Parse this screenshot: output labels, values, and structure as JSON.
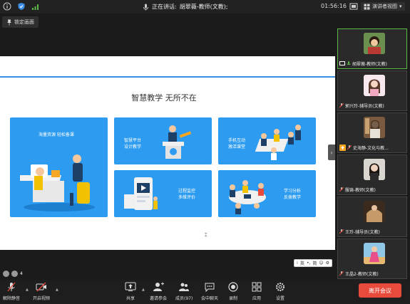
{
  "topbar": {
    "speaking_prefix": "正在讲话:",
    "speaker": "胡翠薇-教师(文教);",
    "time": "01:56:16",
    "view_label": "演讲者视图"
  },
  "lock_label": "锁定画面",
  "slide": {
    "title": "智慧教学 无所不在",
    "cards": [
      {
        "lines": [
          "海量资源 轻松备课"
        ]
      },
      {
        "lines": [
          "智慧平台",
          "设计教学"
        ]
      },
      {
        "lines": [
          "手机互动",
          "激活课堂"
        ]
      },
      {
        "lines": [
          "过程监控",
          "多维评价"
        ]
      },
      {
        "lines": [
          "学习分析",
          "反拨教学"
        ]
      }
    ]
  },
  "ime": {
    "en": "英",
    "simplified": "简"
  },
  "page_number": "4",
  "participants": [
    {
      "name": "胡翠薇-教师(文教)"
    },
    {
      "name": "郭兴玲-辅导员(文教)"
    },
    {
      "name": "史海静-文化与教..."
    },
    {
      "name": "殷铸-教师(文教)"
    },
    {
      "name": "王玲-辅导员(文教)"
    },
    {
      "name": "王晶2-教师(文教)"
    }
  ],
  "toolbar": {
    "mute": "解除静音",
    "video": "开启视频",
    "share": "共享",
    "invite": "邀请参会",
    "members": "成员(97)",
    "chat": "会中聊天",
    "record": "录制",
    "apps": "应用",
    "settings": "设置",
    "leave": "离开会议"
  },
  "colors": {
    "accent": "#2d9cf0",
    "leave": "#e84b3c",
    "active_border": "#5bb846"
  }
}
